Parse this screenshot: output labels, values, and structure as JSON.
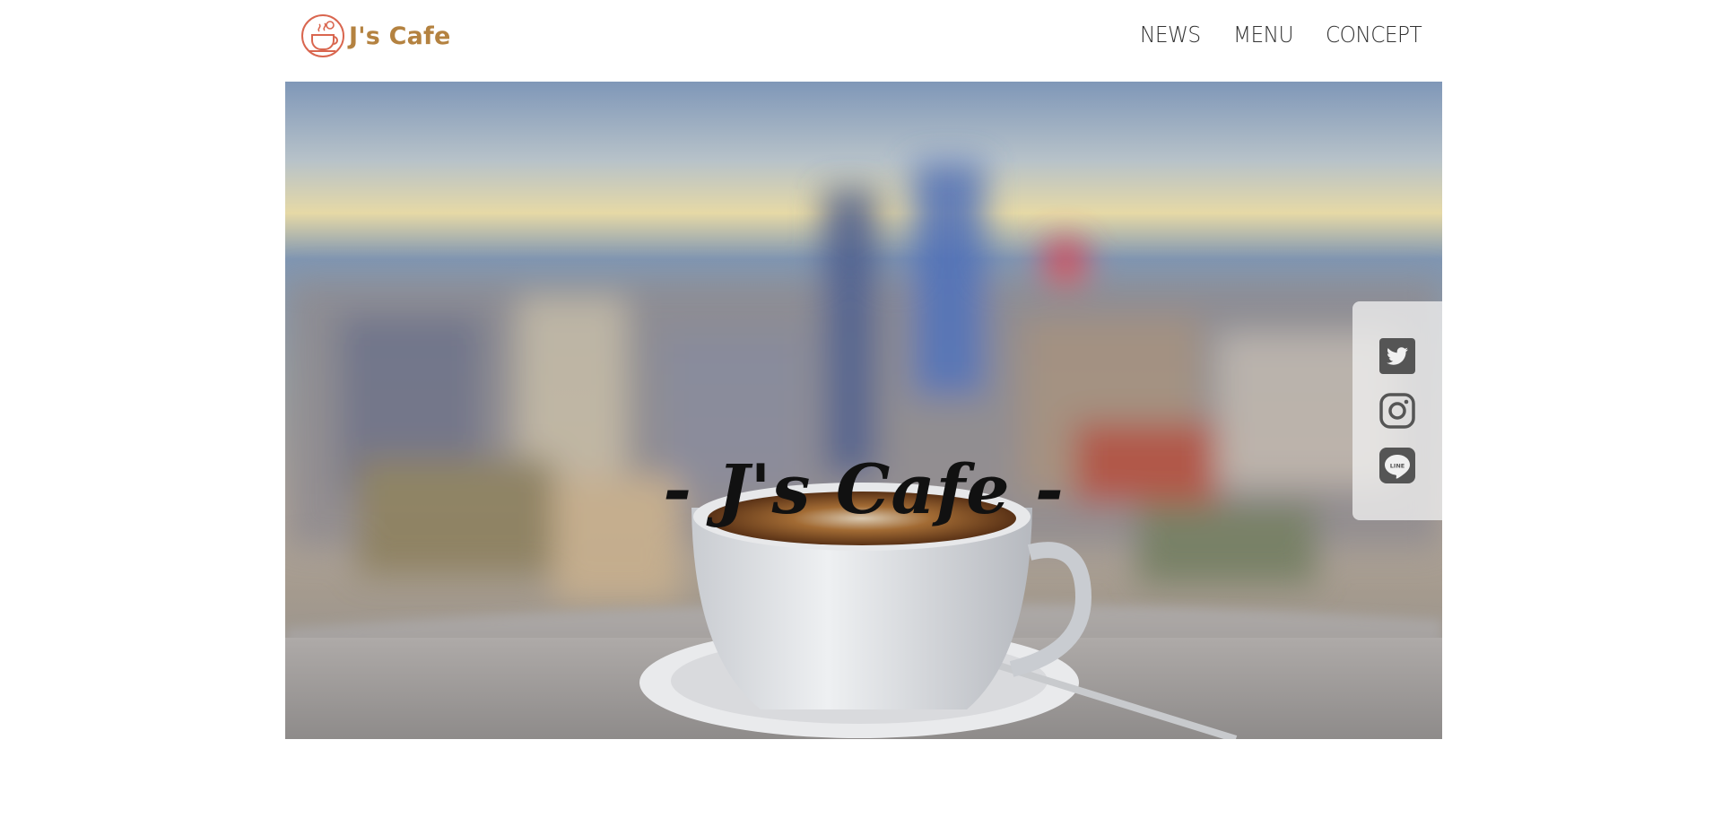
{
  "brand": {
    "name": "J's Cafe",
    "logo_icon": "coffee-cup-logo-icon"
  },
  "nav": [
    {
      "label": "NEWS"
    },
    {
      "label": "MENU"
    },
    {
      "label": "CONCEPT"
    }
  ],
  "hero": {
    "title": "- J's Cafe -"
  },
  "social": [
    {
      "name": "twitter",
      "icon": "twitter-icon"
    },
    {
      "name": "instagram",
      "icon": "instagram-icon"
    },
    {
      "name": "line",
      "icon": "line-icon",
      "label": "LINE"
    }
  ],
  "colors": {
    "brand": "#b48240",
    "logo_line": "#d9664f",
    "nav_text": "#333333",
    "social_icon": "#555555"
  }
}
